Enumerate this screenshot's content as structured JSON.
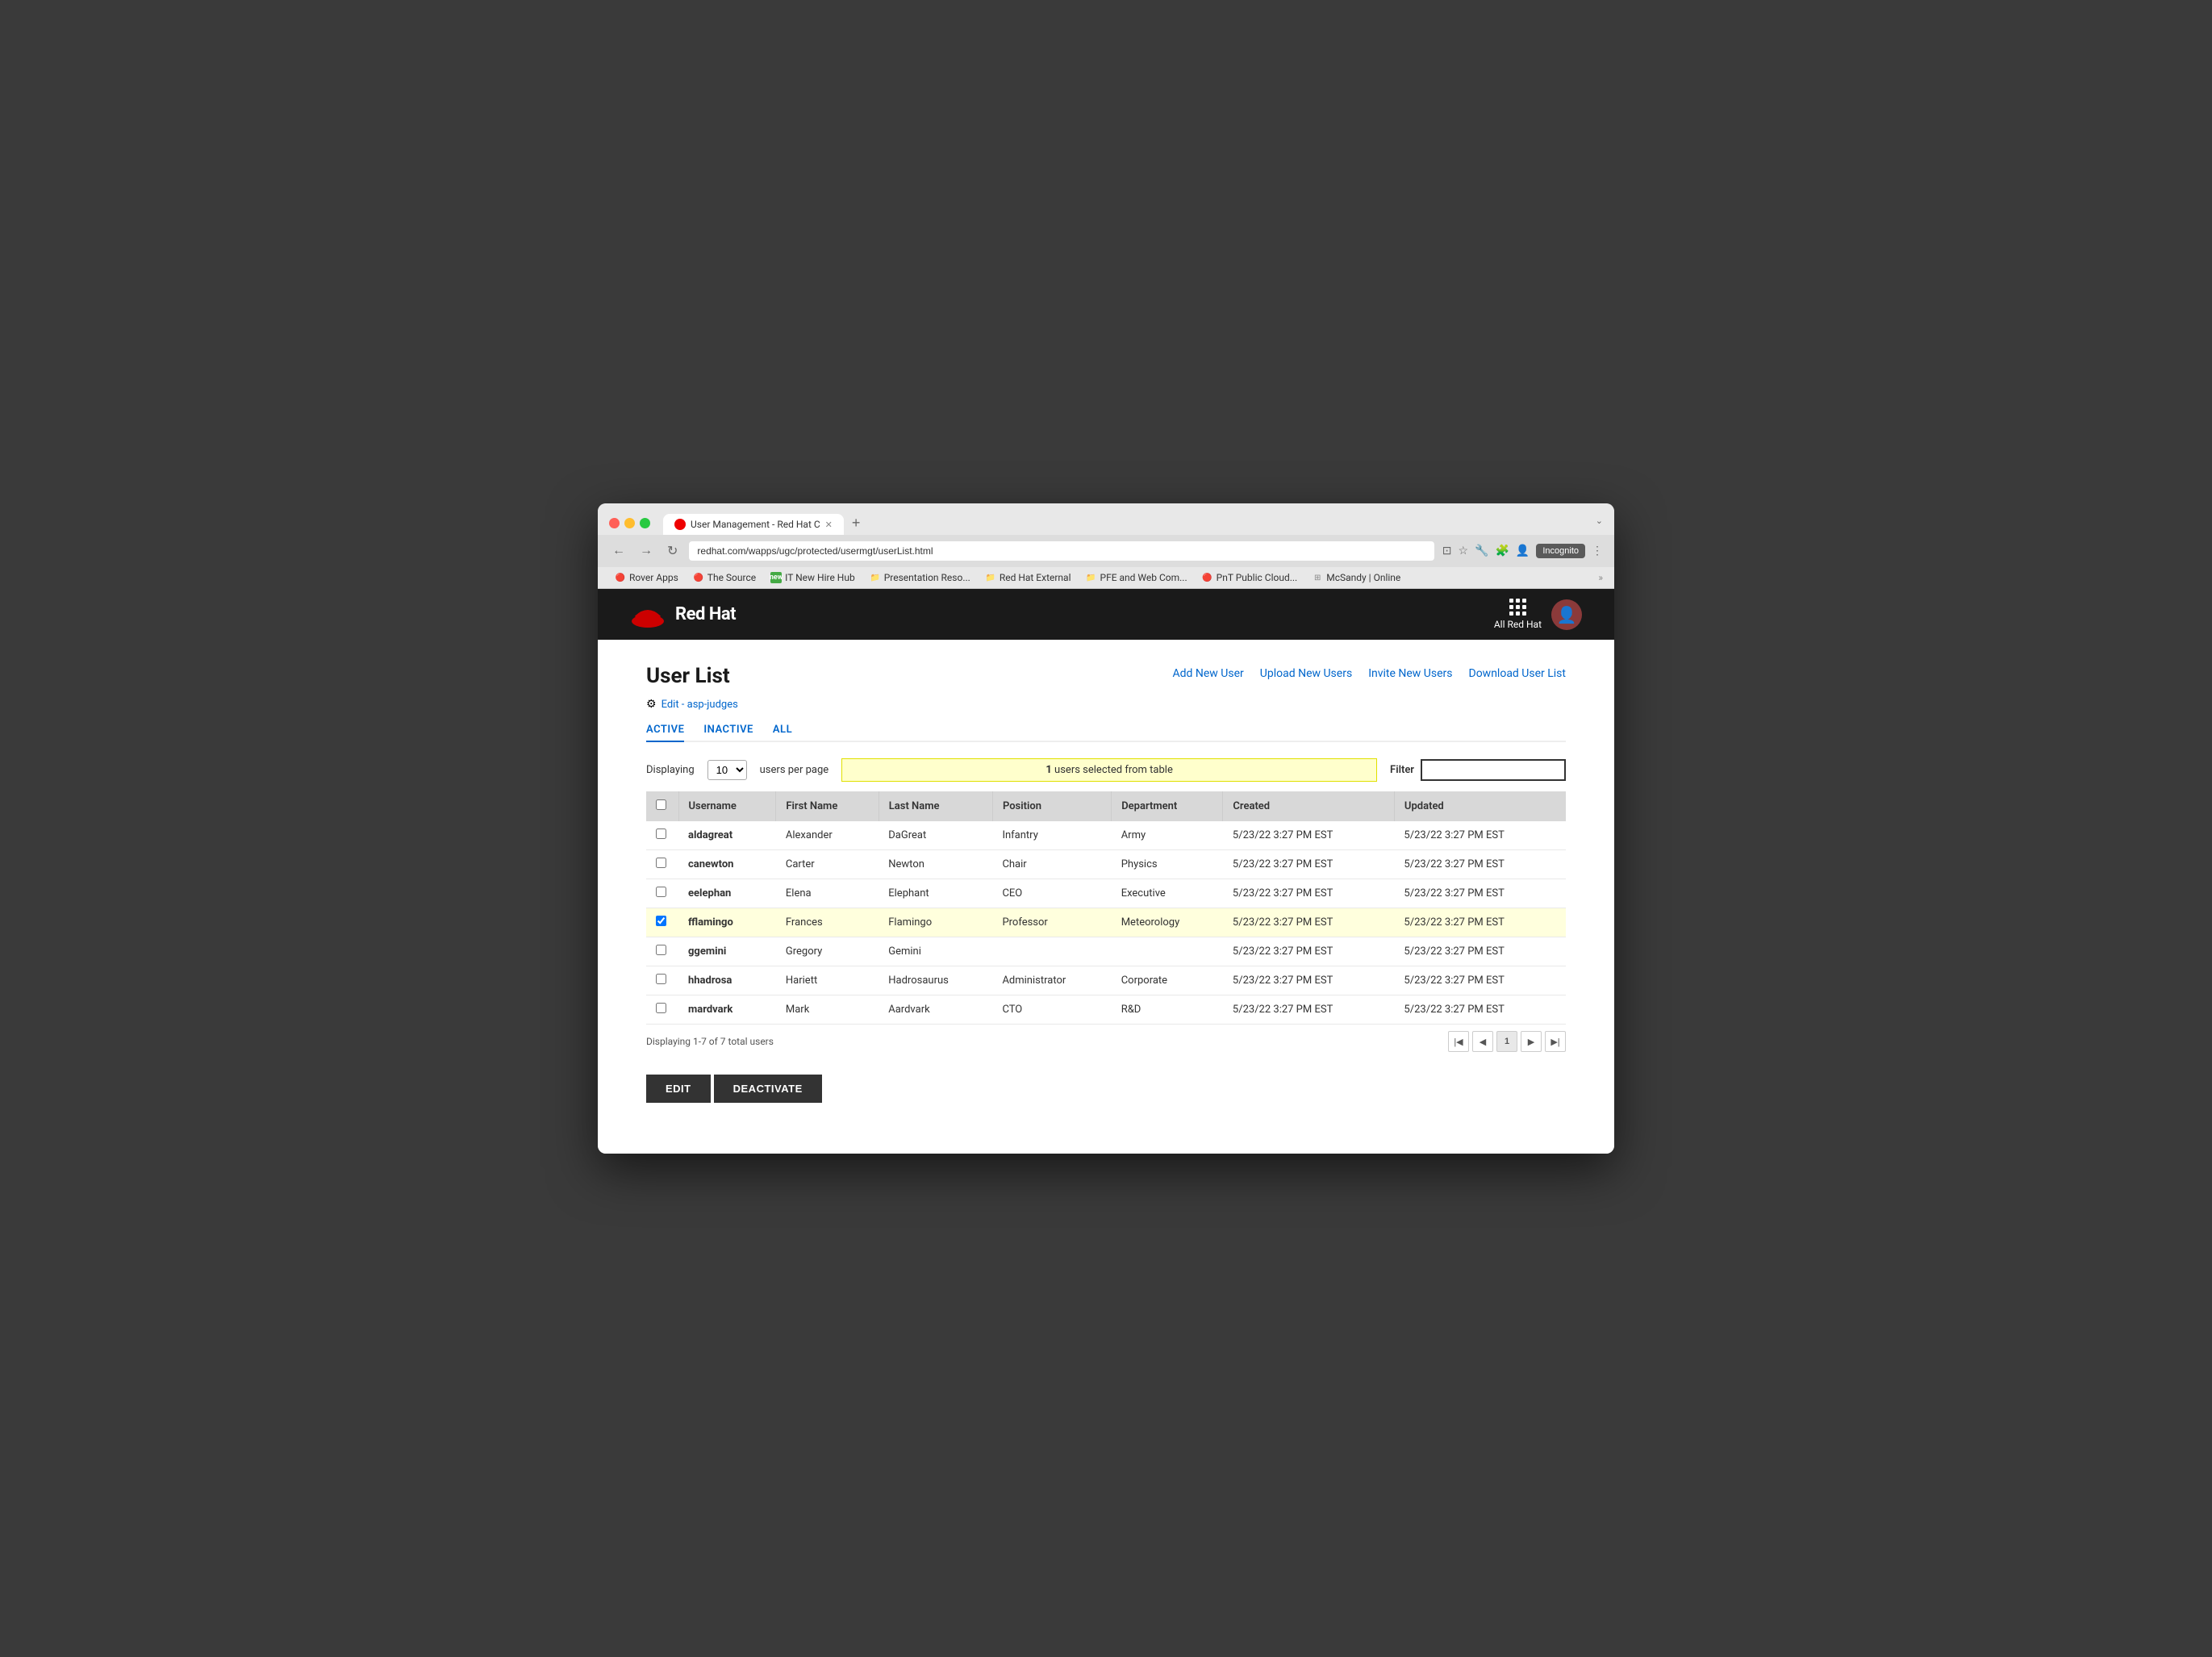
{
  "browser": {
    "tab_title": "User Management - Red Hat C",
    "url": "redhat.com/wapps/ugc/protected/usermgt/userList.html",
    "incognito_label": "Incognito",
    "new_tab_symbol": "+",
    "window_expand": "⌄"
  },
  "bookmarks": [
    {
      "label": "Rover Apps",
      "type": "redhat"
    },
    {
      "label": "The Source",
      "type": "redhat"
    },
    {
      "label": "IT New Hire Hub",
      "type": "new"
    },
    {
      "label": "Presentation Reso...",
      "type": "folder"
    },
    {
      "label": "Red Hat External",
      "type": "folder"
    },
    {
      "label": "PFE and Web Com...",
      "type": "folder"
    },
    {
      "label": "PnT Public Cloud...",
      "type": "redhat"
    },
    {
      "label": "McSandy | Online",
      "type": "folder"
    }
  ],
  "header": {
    "brand": "Red Hat",
    "all_rh_label": "All Red Hat"
  },
  "page": {
    "title": "User List",
    "edit_link": "Edit - asp-judges",
    "action_links": [
      {
        "label": "Add New User",
        "key": "add-new-user"
      },
      {
        "label": "Upload New Users",
        "key": "upload-new-users"
      },
      {
        "label": "Invite New Users",
        "key": "invite-new-users"
      },
      {
        "label": "Download User List",
        "key": "download-user-list"
      }
    ],
    "filter_tabs": [
      {
        "label": "ACTIVE",
        "key": "active",
        "active": true
      },
      {
        "label": "INACTIVE",
        "key": "inactive",
        "active": false
      },
      {
        "label": "ALL",
        "key": "all",
        "active": false
      }
    ],
    "displaying_label": "Displaying",
    "per_page_value": "10",
    "users_per_page_label": "users per page",
    "selected_banner": {
      "count": "1",
      "text": "users selected from table"
    },
    "filter_label": "Filter",
    "filter_placeholder": "",
    "table": {
      "headers": [
        "",
        "Username",
        "First Name",
        "Last Name",
        "Position",
        "Department",
        "Created",
        "Updated"
      ],
      "rows": [
        {
          "username": "aldagreat",
          "first": "Alexander",
          "last": "DaGreat",
          "position": "Infantry",
          "department": "Army",
          "created": "5/23/22 3:27 PM EST",
          "updated": "5/23/22 3:27 PM EST",
          "checked": false,
          "selected": false
        },
        {
          "username": "canewton",
          "first": "Carter",
          "last": "Newton",
          "position": "Chair",
          "department": "Physics",
          "created": "5/23/22 3:27 PM EST",
          "updated": "5/23/22 3:27 PM EST",
          "checked": false,
          "selected": false
        },
        {
          "username": "eelephan",
          "first": "Elena",
          "last": "Elephant",
          "position": "CEO",
          "department": "Executive",
          "created": "5/23/22 3:27 PM EST",
          "updated": "5/23/22 3:27 PM EST",
          "checked": false,
          "selected": false
        },
        {
          "username": "fflamingo",
          "first": "Frances",
          "last": "Flamingo",
          "position": "Professor",
          "department": "Meteorology",
          "created": "5/23/22 3:27 PM EST",
          "updated": "5/23/22 3:27 PM EST",
          "checked": true,
          "selected": true
        },
        {
          "username": "ggemini",
          "first": "Gregory",
          "last": "Gemini",
          "position": "",
          "department": "",
          "created": "5/23/22 3:27 PM EST",
          "updated": "5/23/22 3:27 PM EST",
          "checked": false,
          "selected": false
        },
        {
          "username": "hhadrosa",
          "first": "Hariett",
          "last": "Hadrosaurus",
          "position": "Administrator",
          "department": "Corporate",
          "created": "5/23/22 3:27 PM EST",
          "updated": "5/23/22 3:27 PM EST",
          "checked": false,
          "selected": false
        },
        {
          "username": "mardvark",
          "first": "Mark",
          "last": "Aardvark",
          "position": "CTO",
          "department": "R&D",
          "created": "5/23/22 3:27 PM EST",
          "updated": "5/23/22 3:27 PM EST",
          "checked": false,
          "selected": false
        }
      ]
    },
    "total_label": "Displaying 1-7 of 7 total users",
    "current_page": "1",
    "buttons": {
      "edit": "EDIT",
      "deactivate": "DEACTIVATE"
    }
  }
}
